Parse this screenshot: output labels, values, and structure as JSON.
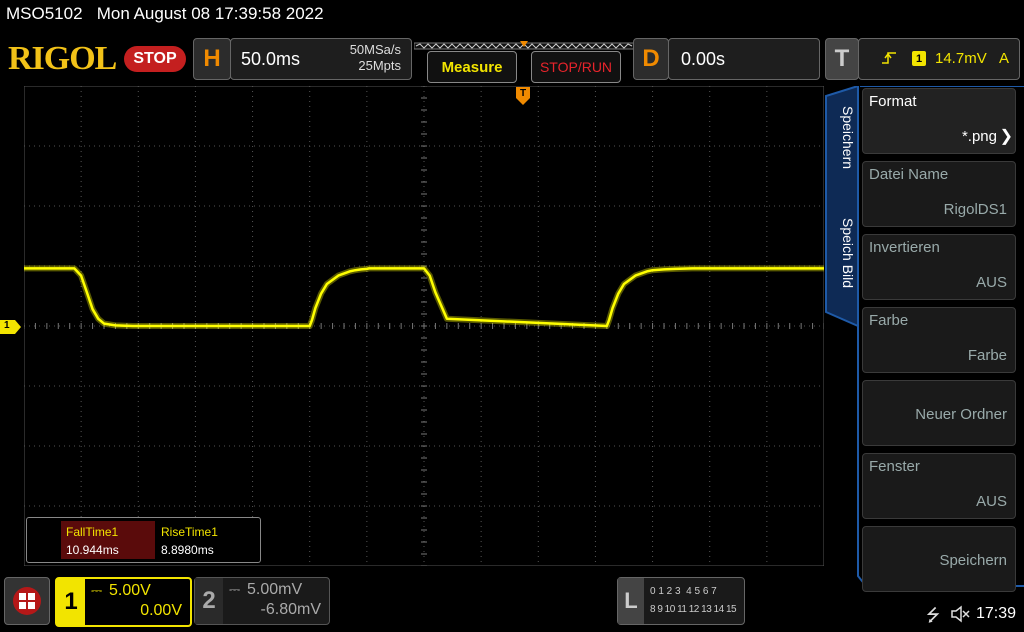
{
  "header": {
    "model": "MSO5102",
    "datetime": "Mon August 08 17:39:58 2022",
    "logo": "RIGOL",
    "run_state": "STOP"
  },
  "timebase": {
    "letter": "H",
    "scale": "50.0ms",
    "sample_rate": "50MSa/s",
    "memory_depth": "25Mpts"
  },
  "buttons": {
    "measure": "Measure",
    "stop_run": "STOP/RUN"
  },
  "delay": {
    "letter": "D",
    "value": "0.00s"
  },
  "trigger": {
    "letter": "T",
    "channel": "1",
    "level": "14.7mV",
    "mode": "A"
  },
  "menu": {
    "tabs": [
      "Speichern",
      "Speich Bild"
    ],
    "items": [
      {
        "title": "Format",
        "value": "*.png"
      },
      {
        "title": "Datei Name",
        "value": "RigolDS1"
      },
      {
        "title": "Invertieren",
        "value": "AUS"
      },
      {
        "title": "Farbe",
        "value": "Farbe"
      },
      {
        "title": "",
        "value": "Neuer Ordner"
      },
      {
        "title": "Fenster",
        "value": "AUS"
      },
      {
        "title": "",
        "value": "Speichern"
      }
    ]
  },
  "measurements": [
    {
      "name": "FallTime1",
      "value": "10.944ms"
    },
    {
      "name": "RiseTime1",
      "value": "8.8980ms"
    }
  ],
  "channels": [
    {
      "number": "1",
      "scale": "5.00V",
      "offset": "0.00V"
    },
    {
      "number": "2",
      "scale": "5.00mV",
      "offset": "-6.80mV"
    }
  ],
  "logic": {
    "letter": "L",
    "row1": "0 1 2 3  4 5 6 7",
    "row2": "8 9 10 11 12 13 14 15"
  },
  "status": {
    "time": "17:39"
  },
  "markers": {
    "ch1": "1",
    "trigger": "T"
  },
  "colors": {
    "ch1": "#ffff00",
    "accent": "#1e5aa8",
    "trigger": "#f08a00"
  },
  "chart_data": {
    "type": "line",
    "title": "",
    "xlabel": "",
    "ylabel": "",
    "x_unit": "ms",
    "y_unit": "V",
    "xlim": [
      -350,
      350
    ],
    "ylim": [
      -20,
      20
    ],
    "grid": true,
    "series": [
      {
        "x": [
          -350,
          -306,
          -300,
          -295,
          -290,
          -285,
          -280,
          -270,
          -255,
          -250,
          -240,
          -100,
          -98,
          -95,
          -90,
          -85,
          -75,
          -65,
          -60,
          -55,
          -50,
          -48,
          -45,
          -40,
          -35,
          -30,
          -25,
          -15,
          -5,
          0,
          5,
          10,
          20,
          160,
          162,
          165,
          170,
          175,
          185,
          195,
          200,
          210,
          220,
          235,
          350
        ],
        "y": [
          4.8,
          4.8,
          4.2,
          2.8,
          1.4,
          0.6,
          0.2,
          0.05,
          0,
          0,
          0,
          0,
          0.5,
          1.5,
          2.7,
          3.5,
          4.2,
          4.55,
          4.65,
          4.72,
          4.76,
          4.8,
          4.8,
          4.8,
          4.8,
          4.8,
          4.8,
          4.8,
          4.8,
          4.8,
          4.2,
          2.8,
          0.6,
          0,
          0.5,
          1.5,
          2.7,
          3.5,
          4.2,
          4.55,
          4.65,
          4.72,
          4.76,
          4.8,
          4.8
        ]
      }
    ]
  }
}
